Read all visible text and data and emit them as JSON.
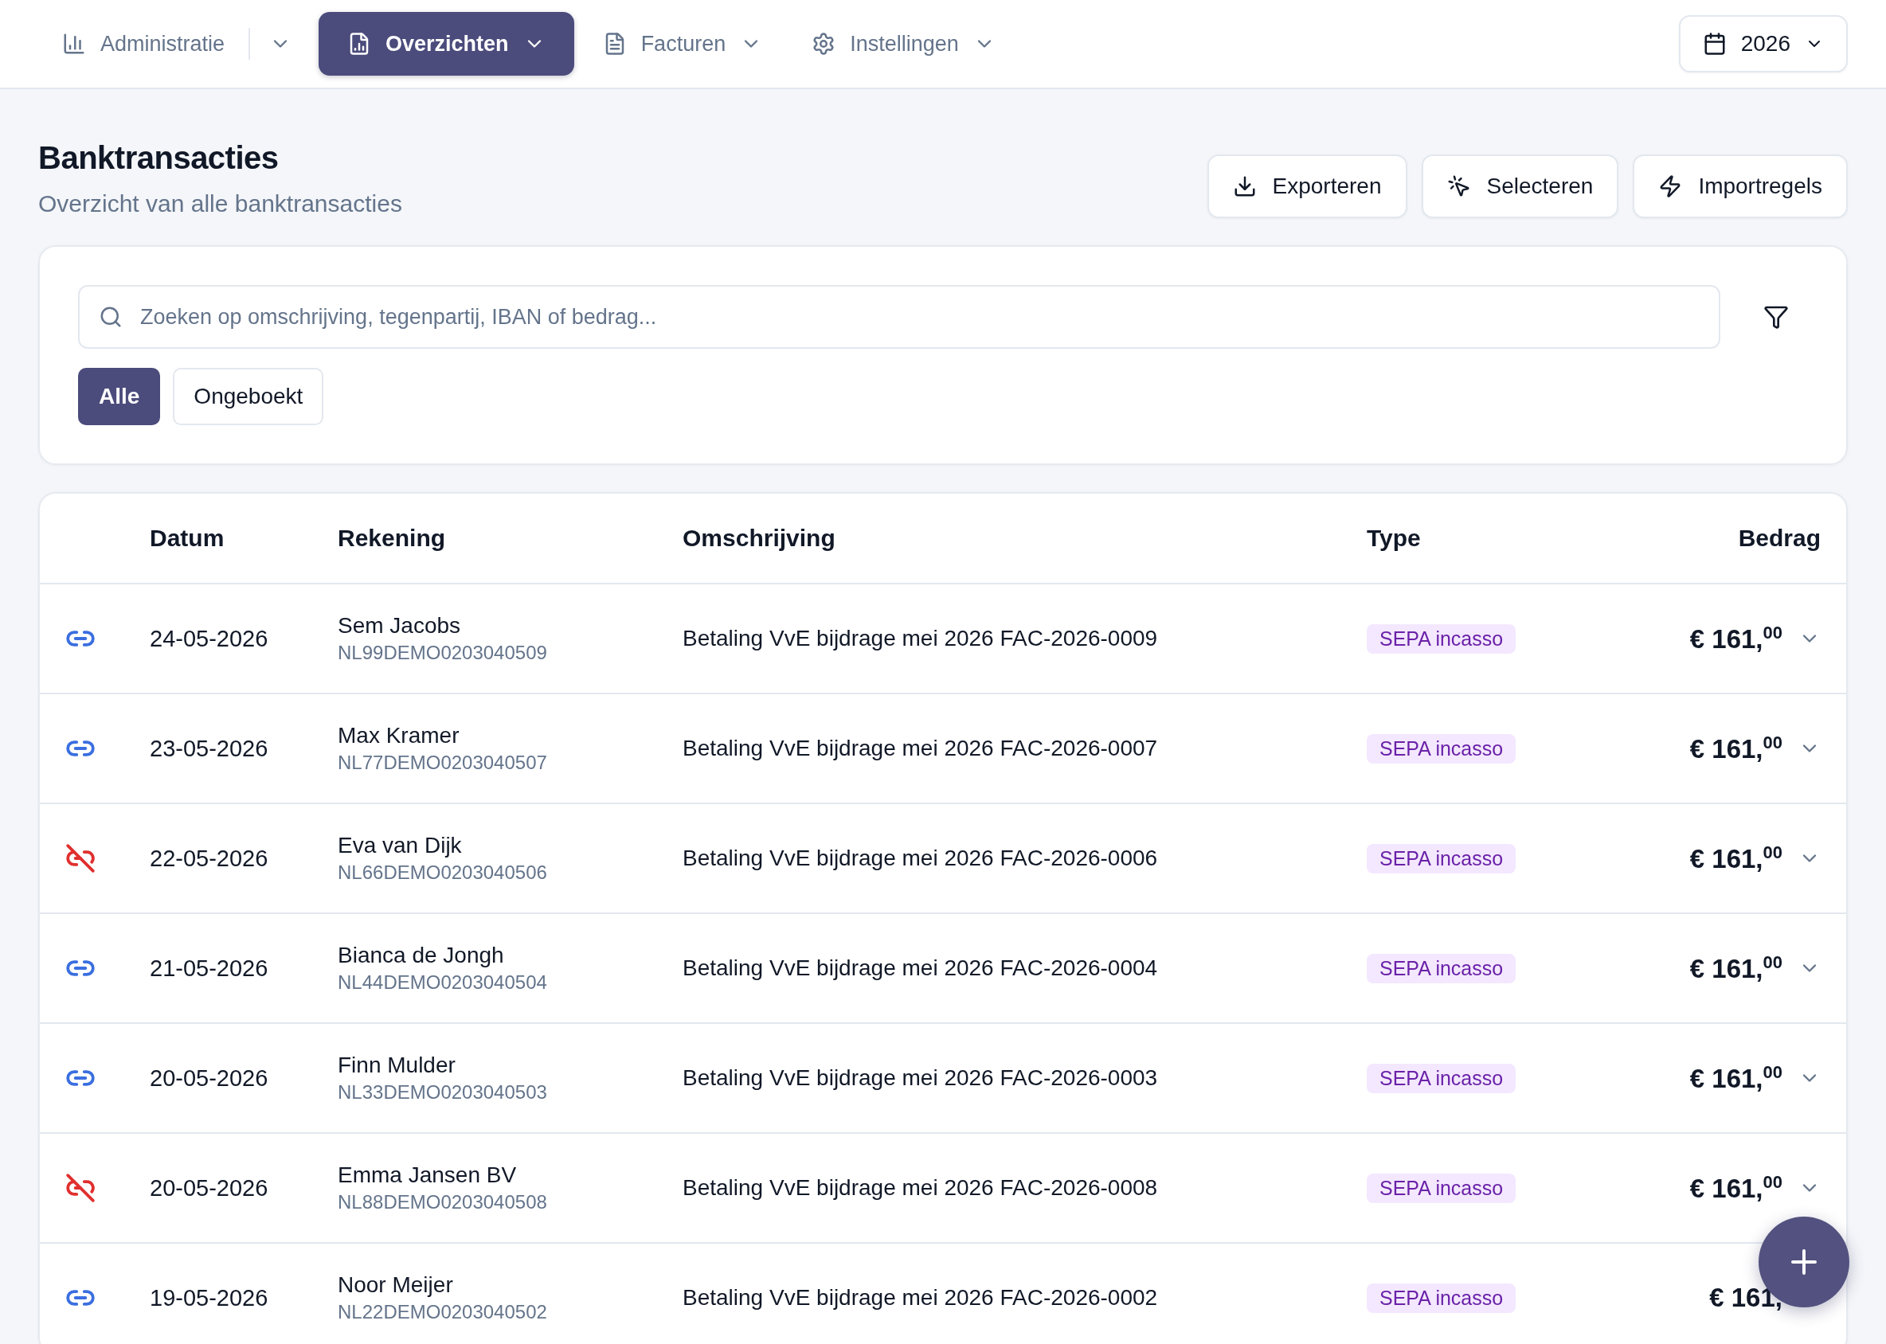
{
  "nav": {
    "items": [
      {
        "label": "Administratie",
        "kind": "split",
        "selected": false
      },
      {
        "label": "Overzichten",
        "kind": "dropdown",
        "selected": true
      },
      {
        "label": "Facturen",
        "kind": "dropdown",
        "selected": false
      },
      {
        "label": "Instellingen",
        "kind": "dropdown",
        "selected": false
      }
    ],
    "year": "2026"
  },
  "header": {
    "title": "Banktransacties",
    "subtitle": "Overzicht van alle banktransacties",
    "actions": [
      {
        "label": "Exporteren"
      },
      {
        "label": "Selecteren"
      },
      {
        "label": "Importregels"
      }
    ]
  },
  "filters": {
    "search": {
      "placeholder": "Zoeken op omschrijving, tegenpartij, IBAN of bedrag..."
    },
    "chips": [
      {
        "label": "Alle",
        "selected": true
      },
      {
        "label": "Ongeboekt",
        "selected": false
      }
    ]
  },
  "table": {
    "columns": [
      "Datum",
      "Rekening",
      "Omschrijving",
      "Type",
      "Bedrag"
    ],
    "rows": [
      {
        "linked": true,
        "date": "24-05-2026",
        "name": "Sem Jacobs",
        "iban": "NL99DEMO0203040509",
        "description": "Betaling VvE bijdrage mei 2026 FAC-2026-0009",
        "type": "SEPA incasso",
        "amount": "€ 161,$^{00}$"
      },
      {
        "linked": true,
        "date": "23-05-2026",
        "name": "Max Kramer",
        "iban": "NL77DEMO0203040507",
        "description": "Betaling VvE bijdrage mei 2026 FAC-2026-0007",
        "type": "SEPA incasso",
        "amount": "€ 161,$^{00}$"
      },
      {
        "linked": false,
        "date": "22-05-2026",
        "name": "Eva van Dijk",
        "iban": "NL66DEMO0203040506",
        "description": "Betaling VvE bijdrage mei 2026 FAC-2026-0006",
        "type": "SEPA incasso",
        "amount": "€ 161,$^{00}$"
      },
      {
        "linked": true,
        "date": "21-05-2026",
        "name": "Bianca de Jongh",
        "iban": "NL44DEMO0203040504",
        "description": "Betaling VvE bijdrage mei 2026 FAC-2026-0004",
        "type": "SEPA incasso",
        "amount": "€ 161,$^{00}$"
      },
      {
        "linked": true,
        "date": "20-05-2026",
        "name": "Finn Mulder",
        "iban": "NL33DEMO0203040503",
        "description": "Betaling VvE bijdrage mei 2026 FAC-2026-0003",
        "type": "SEPA incasso",
        "amount": "€ 161,$^{00}$"
      },
      {
        "linked": false,
        "date": "20-05-2026",
        "name": "Emma Jansen BV",
        "iban": "NL88DEMO0203040508",
        "description": "Betaling VvE bijdrage mei 2026 FAC-2026-0008",
        "type": "SEPA incasso",
        "amount": "€ 161,$^{00}$"
      },
      {
        "linked": true,
        "date": "19-05-2026",
        "name": "Noor Meijer",
        "iban": "NL22DEMO0203040502",
        "description": "Betaling VvE bijdrage mei 2026 FAC-2026-0002",
        "type": "SEPA incasso",
        "amount": "€ 161,"
      }
    ]
  }
}
